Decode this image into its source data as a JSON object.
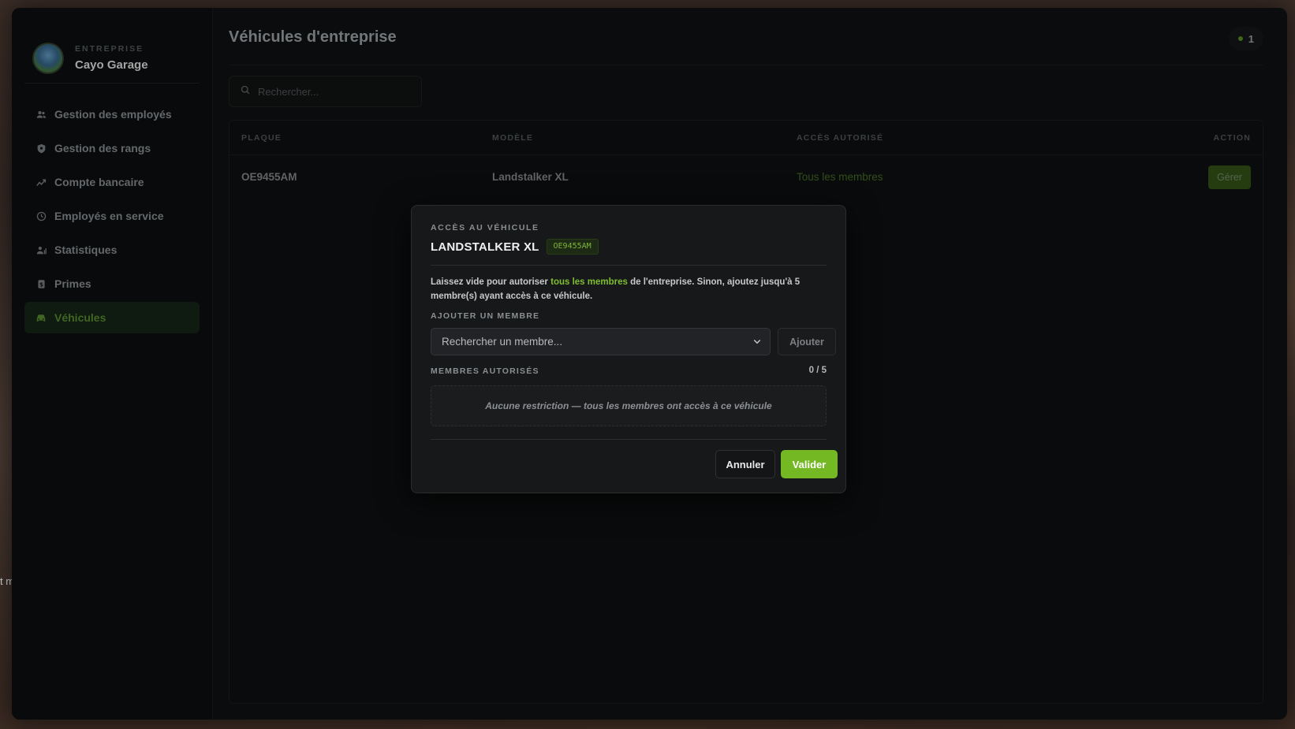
{
  "background_text": "t m",
  "sidebar": {
    "brand_sub": "ENTREPRISE",
    "brand_name": "Cayo Garage",
    "items": [
      {
        "label": "Gestion des employés",
        "icon": "users-icon"
      },
      {
        "label": "Gestion des rangs",
        "icon": "shield-icon"
      },
      {
        "label": "Compte bancaire",
        "icon": "chart-icon"
      },
      {
        "label": "Employés en service",
        "icon": "clock-icon"
      },
      {
        "label": "Statistiques",
        "icon": "user-stats-icon"
      },
      {
        "label": "Primes",
        "icon": "coin-icon"
      },
      {
        "label": "Véhicules",
        "icon": "car-icon",
        "active": true
      }
    ]
  },
  "main": {
    "title": "Véhicules d'entreprise",
    "online_count": "1",
    "search_placeholder": "Rechercher...",
    "table": {
      "headers": [
        "PLAQUE",
        "MODÈLE",
        "ACCÈS AUTORISÉ",
        "ACTION"
      ],
      "rows": [
        {
          "plate": "OE9455AM",
          "model": "Landstalker XL",
          "access": "Tous les membres",
          "action": "Gérer"
        }
      ]
    }
  },
  "modal": {
    "eyebrow": "ACCÈS AU VÉHICULE",
    "title": "LANDSTALKER XL",
    "plate": "OE9455AM",
    "desc_before": "Laissez vide pour autoriser ",
    "desc_highlight": "tous les membres",
    "desc_after": " de l'entreprise. Sinon, ajoutez jusqu'à 5 membre(s) ayant accès à ce véhicule.",
    "add_label": "AJOUTER UN MEMBRE",
    "member_select_placeholder": "Rechercher un membre...",
    "add_button": "Ajouter",
    "authorized_label": "MEMBRES AUTORISÉS",
    "authorized_count": "0 / 5",
    "empty_text": "Aucune restriction — tous les membres ont accès à ce véhicule",
    "cancel_button": "Annuler",
    "ok_button": "Valider"
  },
  "colors": {
    "accent": "#74b823",
    "accent_text": "#7fbf2f",
    "panel": "#0e0f10"
  }
}
